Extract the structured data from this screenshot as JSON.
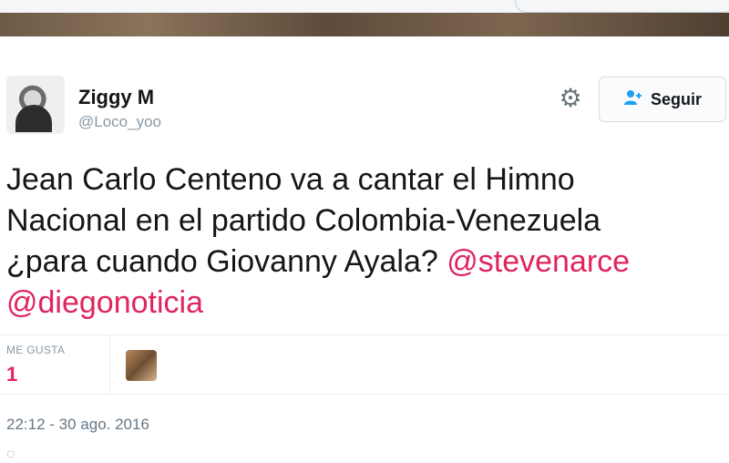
{
  "profile": {
    "name": "Ziggy M",
    "handle": "@Loco_yoo"
  },
  "actions": {
    "follow_label": "Seguir",
    "settings_icon": "gear-icon",
    "follow_icon": "add-user-icon"
  },
  "tweet": {
    "text_lines": [
      "Jean Carlo Centeno va a cantar el Himno",
      "Nacional en el partido Colombia-Venezuela",
      "¿para cuando Giovanny Ayala? "
    ],
    "mentions": [
      "@stevenarce",
      "@diegonoticia"
    ]
  },
  "stats": {
    "likes_label": "ME GUSTA",
    "likes_count": "1"
  },
  "meta": {
    "timestamp": "22:12 - 30 ago. 2016"
  },
  "colors": {
    "mention": "#e0245e",
    "likes": "#e0245e",
    "accent": "#1da1f2"
  }
}
